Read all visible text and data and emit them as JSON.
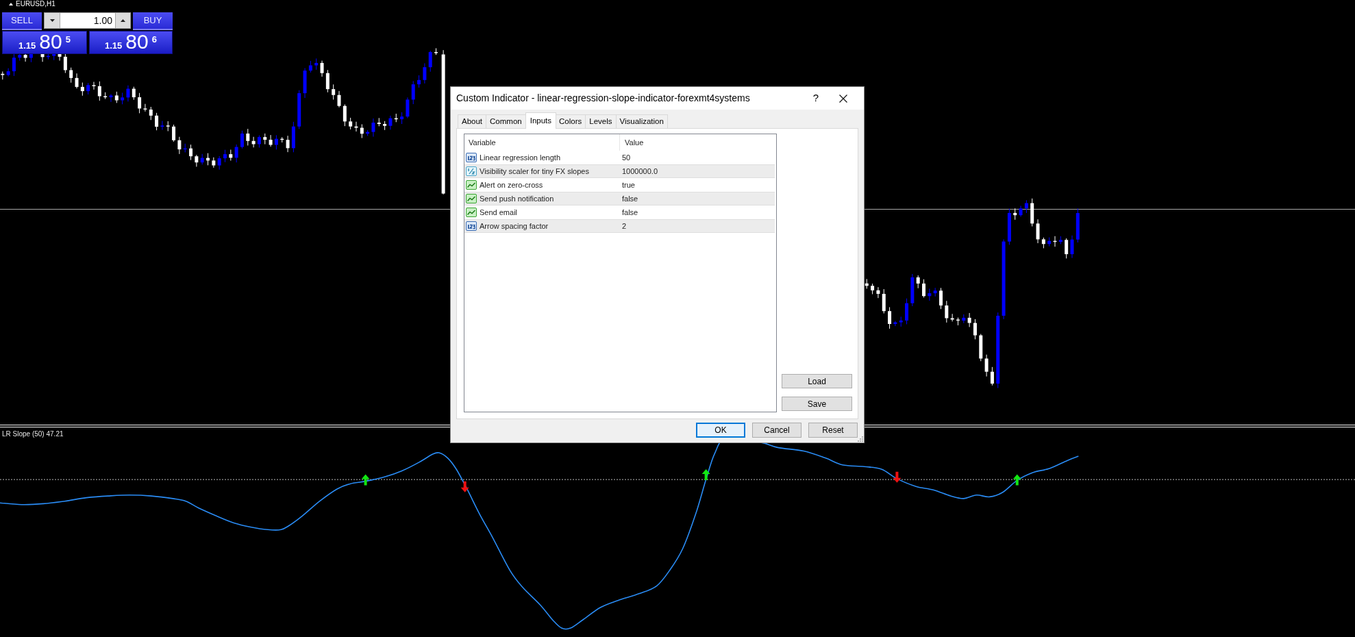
{
  "chart": {
    "title": "EURUSD,H1"
  },
  "trade_panel": {
    "sell_label": "SELL",
    "buy_label": "BUY",
    "lot": "1.00",
    "sell_price": {
      "head": "1.15",
      "big": "80",
      "pip": "5"
    },
    "buy_price": {
      "head": "1.15",
      "big": "80",
      "pip": "6"
    }
  },
  "indicator": {
    "label": "LR Slope (50) 47.21"
  },
  "dialog": {
    "title": "Custom Indicator - linear-regression-slope-indicator-forexmt4systems",
    "help": "?",
    "tabs": [
      {
        "label": "About",
        "selected": false
      },
      {
        "label": "Common",
        "selected": false
      },
      {
        "label": "Inputs",
        "selected": true
      },
      {
        "label": "Colors",
        "selected": false
      },
      {
        "label": "Levels",
        "selected": false
      },
      {
        "label": "Visualization",
        "selected": false
      }
    ],
    "table": {
      "columns": [
        "Variable",
        "Value"
      ],
      "rows": [
        {
          "kind": "int",
          "variable": "Linear regression length",
          "value": "50"
        },
        {
          "kind": "double",
          "variable": "Visibility scaler for tiny FX slopes",
          "value": "1000000.0"
        },
        {
          "kind": "bool",
          "variable": "Alert on zero-cross",
          "value": "true"
        },
        {
          "kind": "bool",
          "variable": "Send push notification",
          "value": "false"
        },
        {
          "kind": "bool",
          "variable": "Send email",
          "value": "false"
        },
        {
          "kind": "int",
          "variable": "Arrow spacing factor",
          "value": "2"
        }
      ]
    },
    "side_buttons": [
      "Load",
      "Save"
    ],
    "buttons": [
      {
        "label": "OK",
        "default": true
      },
      {
        "label": "Cancel",
        "default": false
      },
      {
        "label": "Reset",
        "default": false
      }
    ]
  }
}
